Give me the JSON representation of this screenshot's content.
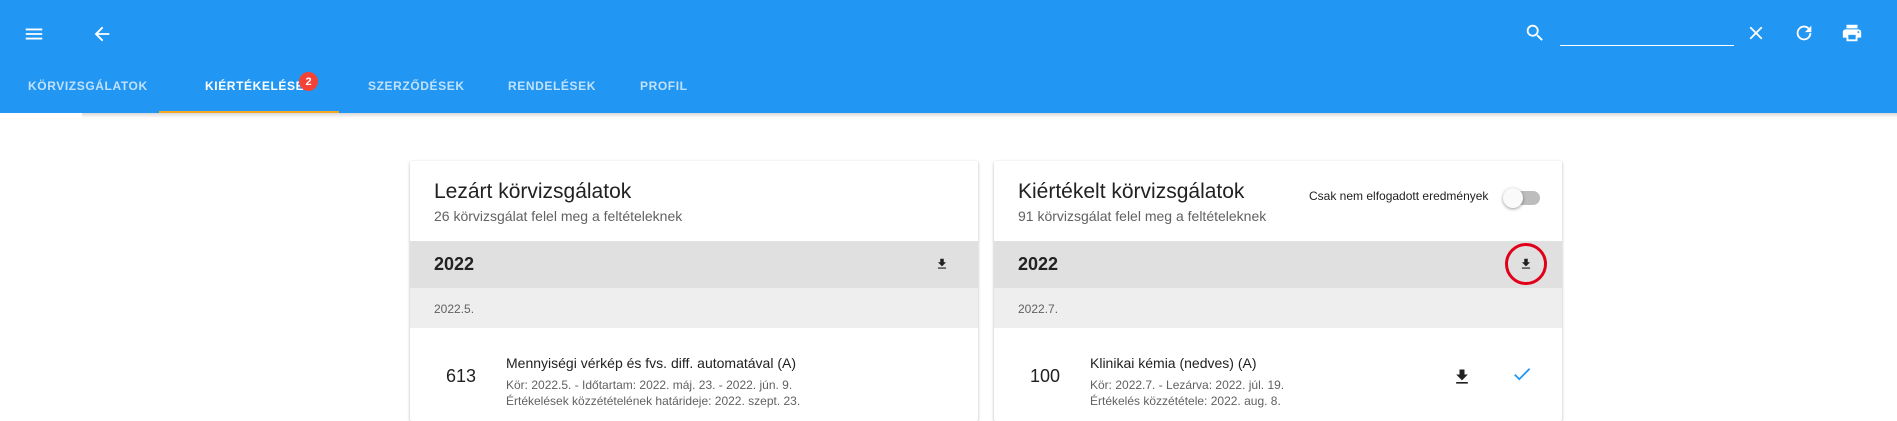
{
  "appbar": {
    "menu_icon": "menu-icon",
    "back_icon": "arrow-back-icon",
    "search_icon": "search-icon",
    "search_value": "",
    "clear_icon": "close-icon",
    "refresh_icon": "refresh-icon",
    "print_icon": "print-icon",
    "color": "#2196f3"
  },
  "tabs": [
    {
      "label": "KÖRVIZSGÁLATOK",
      "active": false
    },
    {
      "label": "KIÉRTÉKELÉSEK",
      "active": true,
      "badge": "2"
    },
    {
      "label": "SZERZŐDÉSEK",
      "active": false
    },
    {
      "label": "RENDELÉSEK",
      "active": false
    },
    {
      "label": "PROFIL",
      "active": false
    }
  ],
  "left_card": {
    "title": "Lezárt körvizsgálatok",
    "subtitle": "26 körvizsgálat felel meg a feltételeknek",
    "year": "2022",
    "month": "2022.5.",
    "item": {
      "number": "613",
      "title": "Mennyiségi vérkép és fvs. diff. automatával (A)",
      "line1": "Kör: 2022.5. - Időtartam: 2022. máj. 23. - 2022. jún. 9.",
      "line2": "Értékelések közzétételének határideje: 2022. szept. 23."
    }
  },
  "right_card": {
    "title": "Kiértékelt körvizsgálatok",
    "subtitle": "91 körvizsgálat felel meg a feltételeknek",
    "toggle_label": "Csak nem elfogadott eredmények",
    "toggle_on": false,
    "year": "2022",
    "month": "2022.7.",
    "item": {
      "number": "100",
      "title": "Klinikai kémia (nedves) (A)",
      "line1": "Kör: 2022.7. - Lezárva: 2022. júl. 19.",
      "line2": "Értékelés közzététele: 2022. aug. 8.",
      "check_color": "#2196f3"
    },
    "highlight_color": "#e0001a"
  }
}
